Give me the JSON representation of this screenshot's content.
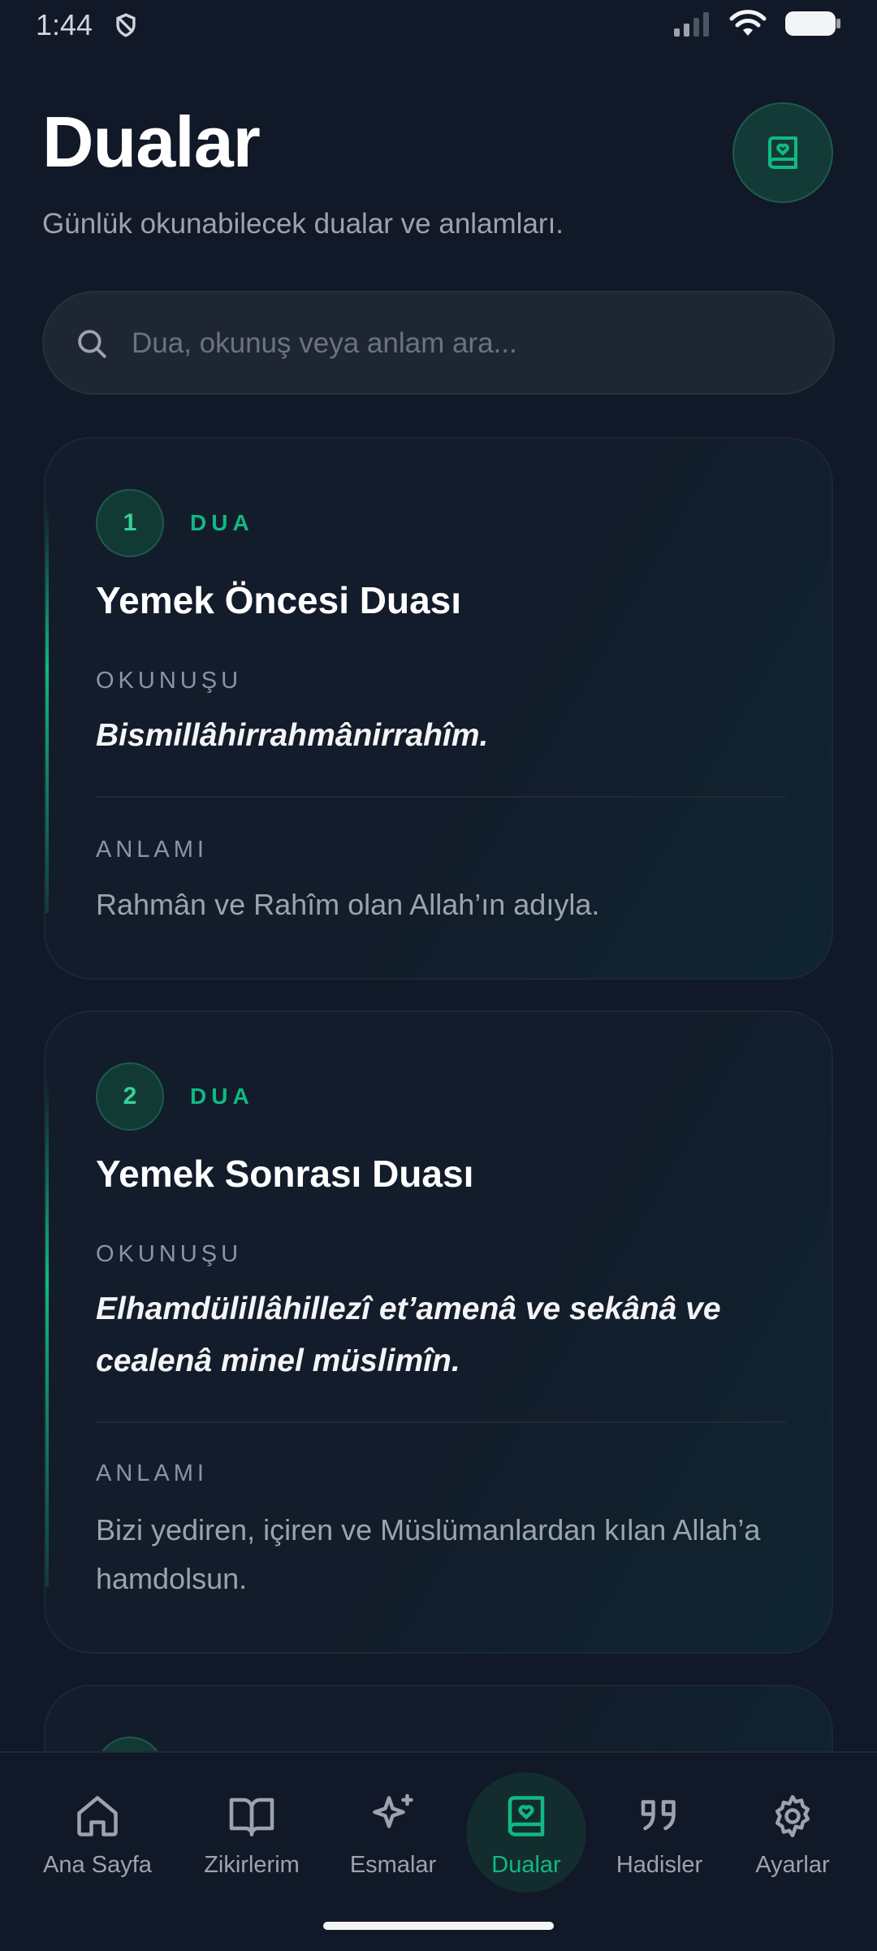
{
  "status": {
    "time": "1:44"
  },
  "header": {
    "title": "Dualar",
    "subtitle": "Günlük okunabilecek dualar ve anlamları.",
    "action_icon": "book-heart-icon"
  },
  "search": {
    "placeholder": "Dua, okunuş veya anlam ara..."
  },
  "cards": [
    {
      "number": "1",
      "kicker": "DUA",
      "title": "Yemek Öncesi Duası",
      "reading_label": "OKUNUŞU",
      "reading": "Bismillâhirrahmânirrahîm.",
      "meaning_label": "ANLAMI",
      "meaning": "Rahmân ve Rahîm olan Allah’ın adıyla."
    },
    {
      "number": "2",
      "kicker": "DUA",
      "title": "Yemek Sonrası Duası",
      "reading_label": "OKUNUŞU",
      "reading": "Elhamdülillâhillezî et’amenâ ve sekânâ ve cealenâ minel müslimîn.",
      "meaning_label": "ANLAMI",
      "meaning": "Bizi yediren, içiren ve Müslümanlardan kılan Allah’a hamdolsun."
    }
  ],
  "nav": [
    {
      "label": "Ana Sayfa",
      "icon": "home-icon"
    },
    {
      "label": "Zikirlerim",
      "icon": "book-open-icon"
    },
    {
      "label": "Esmalar",
      "icon": "sparkles-icon"
    },
    {
      "label": "Dualar",
      "icon": "book-heart-icon",
      "active": true
    },
    {
      "label": "Hadisler",
      "icon": "quote-icon"
    },
    {
      "label": "Ayarlar",
      "icon": "gear-icon"
    }
  ],
  "colors": {
    "background": "#111827",
    "accent": "#10b981",
    "card": "#131c2b"
  }
}
